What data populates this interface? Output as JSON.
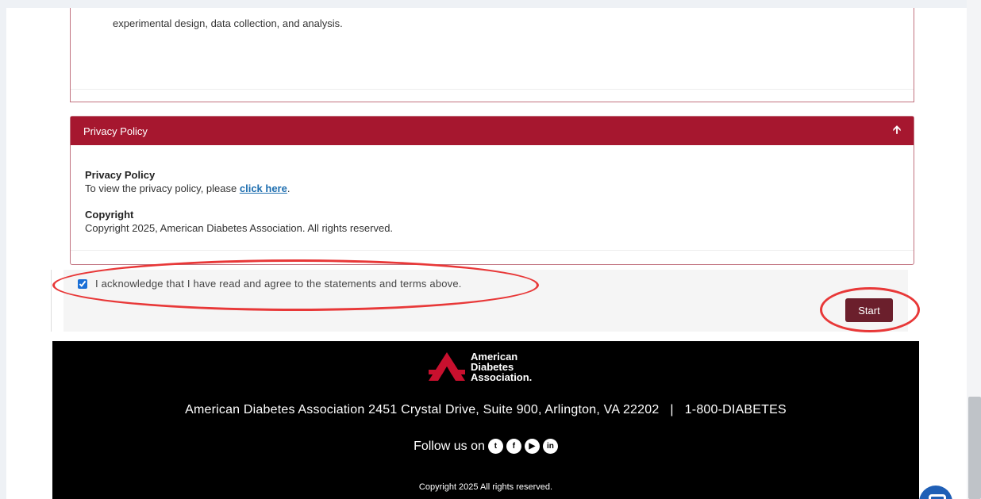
{
  "previous_section": {
    "text": "experimental design, data collection, and analysis."
  },
  "privacy_panel": {
    "header_label": "Privacy Policy",
    "toggle_icon": "arrow-up-icon",
    "privacy_title": "Privacy Policy",
    "privacy_text": "To view the privacy policy, please ",
    "privacy_link": "click here",
    "privacy_text_end": ".",
    "copyright_title": "Copyright",
    "copyright_text": "Copyright 2025, American Diabetes Association. All rights reserved."
  },
  "acknowledge": {
    "checked": true,
    "label": "I acknowledge that I have read and agree to the statements and terms above.",
    "start_label": "Start"
  },
  "footer": {
    "logo_line1": "American",
    "logo_line2": "Diabetes",
    "logo_line3": "Association.",
    "address": "American Diabetes Association 2451 Crystal Drive, Suite 900, Arlington, VA 22202",
    "phone": "1-800-DIABETES",
    "follow_label": "Follow us on",
    "social": [
      {
        "name": "twitter-icon",
        "glyph": "t"
      },
      {
        "name": "facebook-icon",
        "glyph": "f"
      },
      {
        "name": "youtube-icon",
        "glyph": "▶"
      },
      {
        "name": "linkedin-icon",
        "glyph": "in"
      }
    ],
    "copyright": "Copyright 2025 All rights reserved."
  },
  "colors": {
    "panel_header": "#a6172f",
    "start_button": "#6b1f2c",
    "annotation": "#e83838",
    "footer_bg": "#000000"
  }
}
